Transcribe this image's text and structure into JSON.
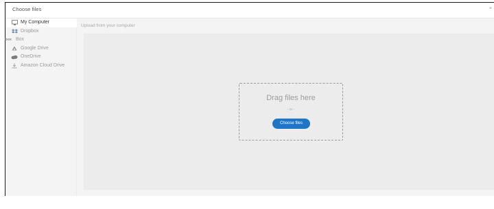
{
  "modal": {
    "title": "Choose files",
    "close": "×"
  },
  "sidebar": {
    "items": [
      {
        "label": "My Computer",
        "icon": "computer-icon",
        "active": true
      },
      {
        "label": "Dropbox",
        "icon": "dropbox-icon",
        "active": false
      },
      {
        "label": "Box",
        "icon": "box-icon",
        "icon_text": "box",
        "active": false
      },
      {
        "label": "Google Drive",
        "icon": "google-drive-icon",
        "active": false
      },
      {
        "label": "OneDrive",
        "icon": "onedrive-icon",
        "active": false
      },
      {
        "label": "Amazon Cloud Drive",
        "icon": "amazon-cloud-drive-icon",
        "active": false
      }
    ]
  },
  "content": {
    "heading": "Upload from your computer",
    "drag_text": "Drag files here",
    "or_text": "- or -",
    "choose_button": "Choose files"
  },
  "colors": {
    "accent": "#1f76c8",
    "background": "#f4f4f4",
    "drop_area": "#ececec"
  }
}
